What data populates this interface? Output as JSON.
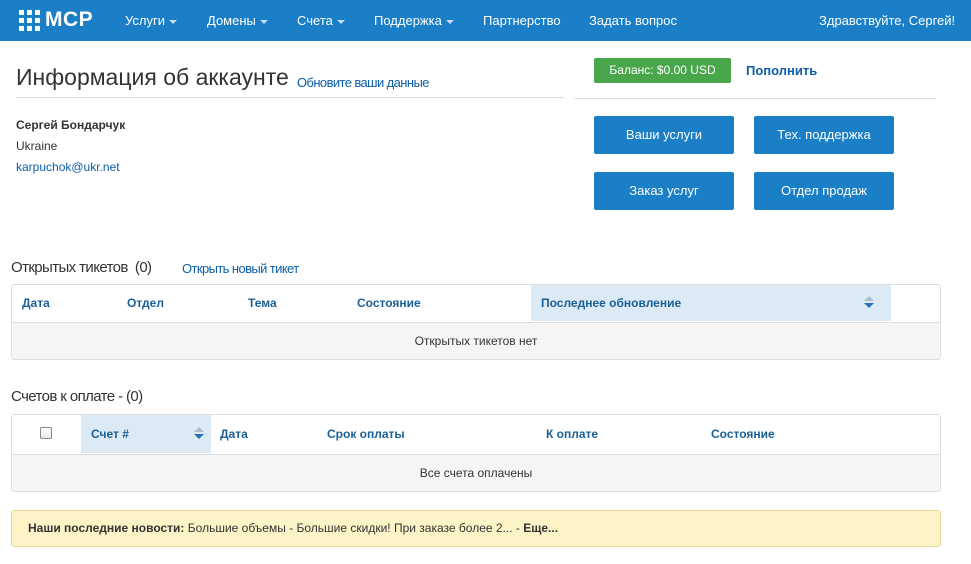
{
  "navbar": {
    "logo_text": "MCP",
    "items": [
      {
        "label": "Услуги",
        "dropdown": true
      },
      {
        "label": "Домены",
        "dropdown": true
      },
      {
        "label": "Счета",
        "dropdown": true
      },
      {
        "label": "Поддержка",
        "dropdown": true
      },
      {
        "label": "Партнерство",
        "dropdown": false
      },
      {
        "label": "Задать вопрос",
        "dropdown": false
      }
    ],
    "greeting": "Здравствуйте, Сергей!",
    "color": "#1a7fc6"
  },
  "account": {
    "title": "Информация об аккаунте",
    "update_link": "Обновите ваши данные",
    "name": "Сергей Бондарчук",
    "country": "Ukraine",
    "email": "karpuchok@ukr.net"
  },
  "balance": {
    "label": "Баланс: $0.00 USD",
    "topup": "Пополнить",
    "color": "#4aa64a"
  },
  "quick_buttons": {
    "services": "Ваши услуги",
    "support": "Тех. поддержка",
    "order": "Заказ услуг",
    "sales": "Отдел продаж"
  },
  "tickets": {
    "title": "Открытых тикетов",
    "count": "(0)",
    "new_link": "Открыть новый тикет",
    "columns": [
      "Дата",
      "Отдел",
      "Тема",
      "Состояние",
      "Последнее обновление"
    ],
    "empty": "Открытых тикетов нет"
  },
  "invoices": {
    "title": "Счетов к оплате - (0)",
    "columns": [
      "Счет #",
      "Дата",
      "Срок оплаты",
      "К оплате",
      "Состояние"
    ],
    "empty": "Все счета оплачены"
  },
  "news": {
    "label": "Наши последние новости:",
    "text": "Большие объемы - Большие скидки! При заказе более 2...",
    "separator": "-",
    "more": "Еще..."
  }
}
